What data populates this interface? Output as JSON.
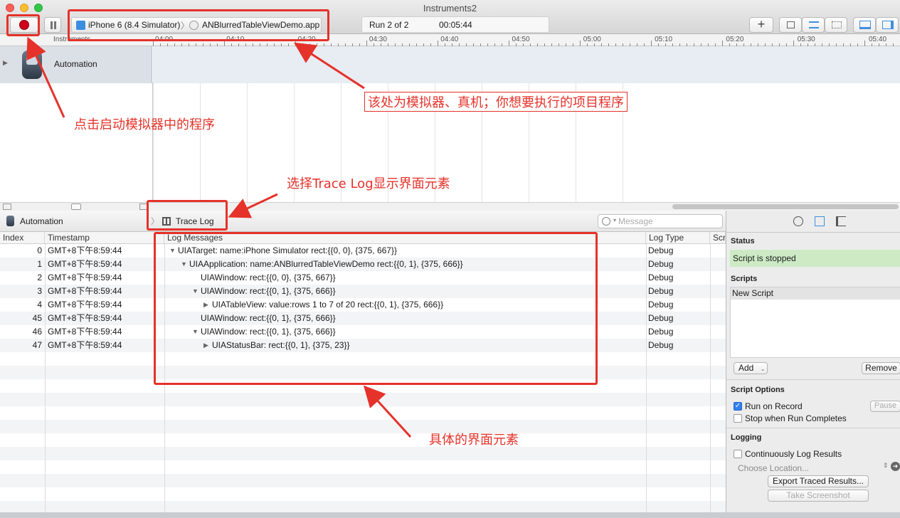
{
  "window": {
    "title": "Instruments2"
  },
  "colors": {
    "record": "#d0021b",
    "annotation": "#e5322a",
    "status_ok": "#cdeac5",
    "selection": "#dbe0e6"
  },
  "toolbar": {
    "device": "iPhone 6 (8.4 Simulator)",
    "app": "ANBlurredTableViewDemo.app",
    "run": "Run 2 of 2",
    "time": "00:05:44",
    "add_label": "+"
  },
  "ruler": {
    "header": "Instruments",
    "ticks": [
      "04:00",
      "04:10",
      "04:20",
      "04:30",
      "04:40",
      "04:50",
      "05:00",
      "05:10",
      "05:20",
      "05:30",
      "05:40"
    ]
  },
  "instrument": {
    "name": "Automation",
    "icon": "automation-robot-icon"
  },
  "detail": {
    "instrument": "Automation",
    "view": "Trace Log",
    "search_placeholder": "Message"
  },
  "table": {
    "columns": [
      "Index",
      "Timestamp",
      "Log Messages",
      "Log Type",
      "Scr"
    ],
    "rows": [
      {
        "index": "0",
        "time": "GMT+8下午8:59:44",
        "indent": 0,
        "disclosure": "open",
        "message": "UIATarget: name:iPhone Simulator rect:{{0, 0}, {375, 667}}",
        "type": "Debug"
      },
      {
        "index": "1",
        "time": "GMT+8下午8:59:44",
        "indent": 1,
        "disclosure": "open",
        "message": "UIAApplication: name:ANBlurredTableViewDemo rect:{{0, 1}, {375, 666}}",
        "type": "Debug"
      },
      {
        "index": "2",
        "time": "GMT+8下午8:59:44",
        "indent": 2,
        "disclosure": "none",
        "message": "UIAWindow: rect:{{0, 0}, {375, 667}}",
        "type": "Debug"
      },
      {
        "index": "3",
        "time": "GMT+8下午8:59:44",
        "indent": 2,
        "disclosure": "open",
        "message": "UIAWindow: rect:{{0, 1}, {375, 666}}",
        "type": "Debug"
      },
      {
        "index": "4",
        "time": "GMT+8下午8:59:44",
        "indent": 3,
        "disclosure": "closed",
        "message": "UIATableView: value:rows 1 to 7 of 20 rect:{{0, 1}, {375, 666}}",
        "type": "Debug"
      },
      {
        "index": "45",
        "time": "GMT+8下午8:59:44",
        "indent": 2,
        "disclosure": "none",
        "message": "UIAWindow: rect:{{0, 1}, {375, 666}}",
        "type": "Debug"
      },
      {
        "index": "46",
        "time": "GMT+8下午8:59:44",
        "indent": 2,
        "disclosure": "open",
        "message": "UIAWindow: rect:{{0, 1}, {375, 666}}",
        "type": "Debug"
      },
      {
        "index": "47",
        "time": "GMT+8下午8:59:44",
        "indent": 3,
        "disclosure": "closed",
        "message": "UIAStatusBar: rect:{{0, 1}, {375, 23}}",
        "type": "Debug"
      }
    ]
  },
  "inspector": {
    "status_title": "Status",
    "status_text": "Script is stopped",
    "scripts_title": "Scripts",
    "script_item": "New Script",
    "add_label": "Add",
    "remove_label": "Remove",
    "options_title": "Script Options",
    "run_on_record": "Run on Record",
    "run_on_record_checked": true,
    "pause_label": "Pause",
    "stop_when_done": "Stop when Run Completes",
    "stop_when_done_checked": false,
    "logging_title": "Logging",
    "continuous_log": "Continuously Log Results",
    "continuous_log_checked": false,
    "choose_location": "Choose Location...",
    "export_label": "Export Traced Results...",
    "screenshot_label": "Take Screenshot"
  },
  "annotations": {
    "record": "点击启动模拟器中的程序",
    "target": "该处为模拟器、真机；你想要执行的项目程序",
    "trace_log": "选择Trace Log显示界面元素",
    "elements": "具体的界面元素"
  }
}
